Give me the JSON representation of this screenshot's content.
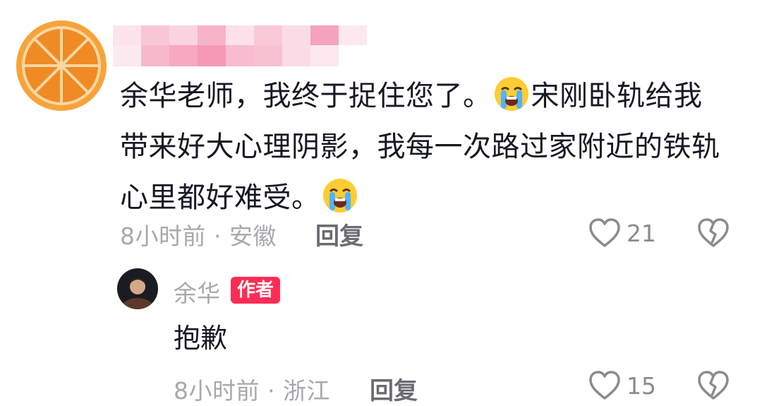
{
  "comment": {
    "text_line1_a": "余华老师，我终于捉住您了。",
    "emoji_1": "loudly-crying-face",
    "text_line1_b": "宋刚卧轨给我",
    "text_line2": "带来好大心理阴影，我每一次路过家附近的铁轨",
    "text_line3": "心里都好难受。",
    "emoji_2": "loudly-crying-face",
    "time_location": "8小时前 · 安徽",
    "reply_label": "回复",
    "like_count": "21"
  },
  "reply": {
    "author_name": "余华",
    "author_badge": "作者",
    "text": "抱歉",
    "time_location": "8小时前 · 浙江",
    "reply_label": "回复",
    "like_count": "15"
  },
  "colors": {
    "badge": "#fe2c55",
    "meta_text": "#a8a9ad",
    "body_text": "#161823",
    "avatar_orange": "#f08a24"
  }
}
